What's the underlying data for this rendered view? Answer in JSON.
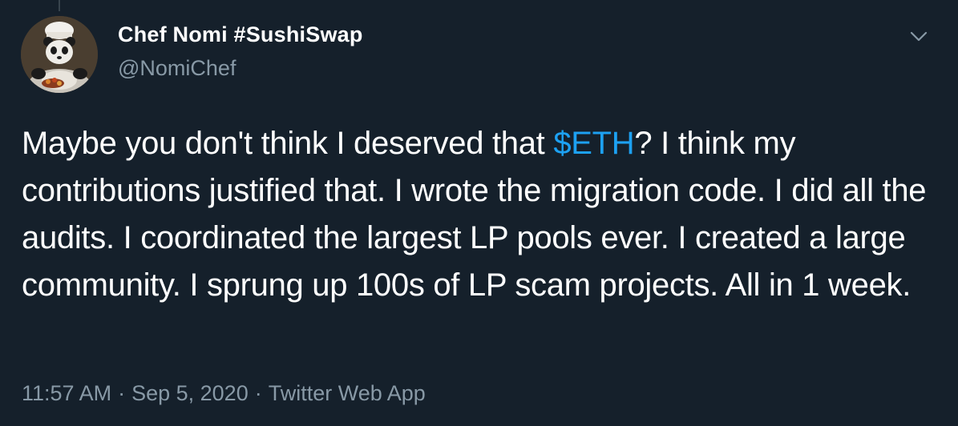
{
  "tweet": {
    "author": {
      "display_name": "Chef Nomi #SushiSwap",
      "handle": "@NomiChef",
      "avatar_icon": "chef-panda-avatar"
    },
    "text_before_cashtag": "Maybe you don't think I deserved that ",
    "cashtag": "$ETH",
    "text_after_cashtag": "? I think my contributions justified that. I wrote the migration code. I did all the audits. I coordinated the largest LP pools ever. I created a large community. I sprung up 100s of LP scam projects. All in 1 week.",
    "time": "11:57 AM",
    "date": "Sep 5, 2020",
    "source": "Twitter Web App",
    "separator": "·"
  },
  "icons": {
    "menu": "chevron-down-icon"
  },
  "colors": {
    "background": "#15202b",
    "text": "#ffffff",
    "secondary_text": "#8899a6",
    "link": "#1da1f2"
  }
}
